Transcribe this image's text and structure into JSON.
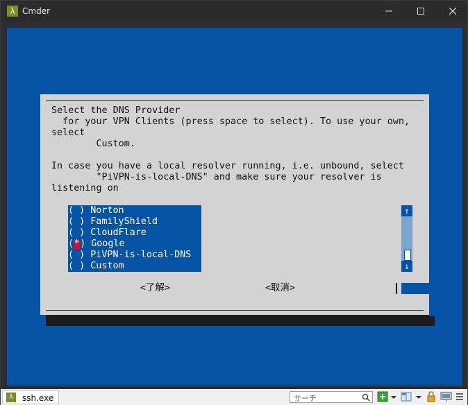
{
  "window": {
    "title": "Cmder",
    "app_icon_glyph": "λ"
  },
  "dialog": {
    "lines": [
      "Select the DNS Provider",
      "  for your VPN Clients (press space to select). To use your own,",
      "select",
      "        Custom.",
      "",
      "In case you have a local resolver running, i.e. unbound, select",
      "        \"PiVPN-is-local-DNS\" and make sure your resolver is",
      "listening on"
    ],
    "options": [
      {
        "label": "Norton",
        "selected": false
      },
      {
        "label": "FamilyShield",
        "selected": false
      },
      {
        "label": "CloudFlare",
        "selected": false
      },
      {
        "label": "Google",
        "selected": true
      },
      {
        "label": "PiVPN-is-local-DNS",
        "selected": false
      },
      {
        "label": "Custom",
        "selected": false
      }
    ],
    "radio_open": "(",
    "radio_close": ")",
    "radio_mark": "*",
    "ok_label": "<了解>",
    "cancel_label": "<取消>",
    "scroll_up_glyph": "↑",
    "scroll_down_glyph": "↓"
  },
  "statusbar": {
    "tab_label": "ssh.exe",
    "search_placeholder": "サーチ"
  },
  "colors": {
    "terminal_bg": "#0453a4",
    "dialog_bg": "#d3d3d3",
    "selected_radio": "#c8143c"
  }
}
